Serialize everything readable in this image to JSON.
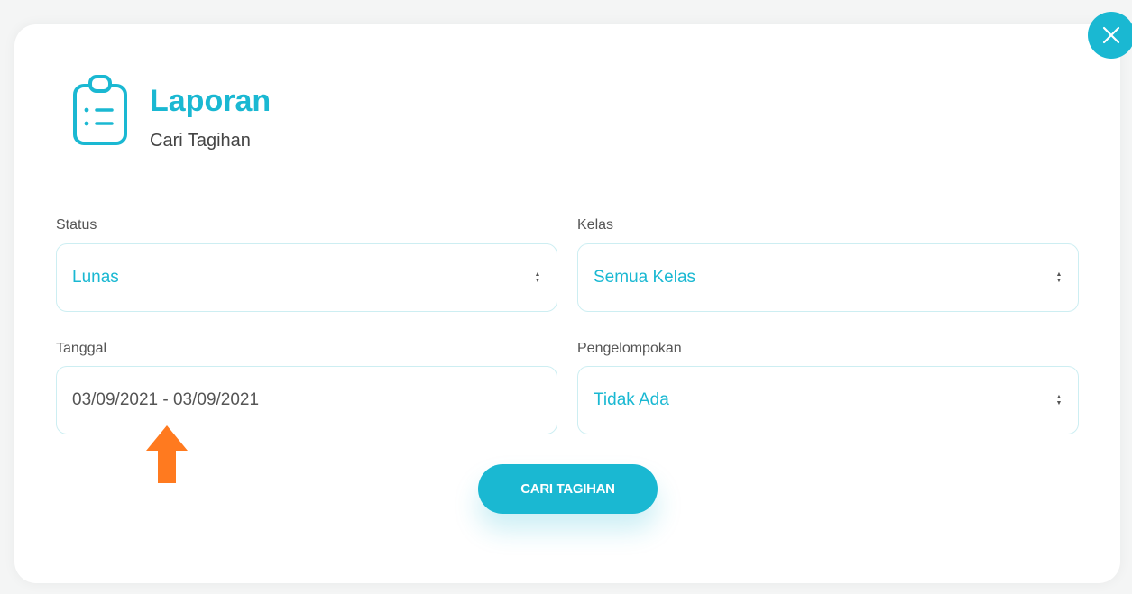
{
  "header": {
    "title": "Laporan",
    "subtitle": "Cari Tagihan",
    "icon": "clipboard-list-icon"
  },
  "form": {
    "status": {
      "label": "Status",
      "value": "Lunas"
    },
    "kelas": {
      "label": "Kelas",
      "value": "Semua Kelas"
    },
    "tanggal": {
      "label": "Tanggal",
      "value": "03/09/2021 - 03/09/2021"
    },
    "pengelompokan": {
      "label": "Pengelompokan",
      "value": "Tidak Ada"
    }
  },
  "actions": {
    "search_label": "CARI TAGIHAN",
    "close_icon": "close-icon"
  },
  "colors": {
    "accent": "#1ab8d2",
    "field_border": "#cdeef2",
    "annotation_arrow": "#ff7a1f"
  }
}
